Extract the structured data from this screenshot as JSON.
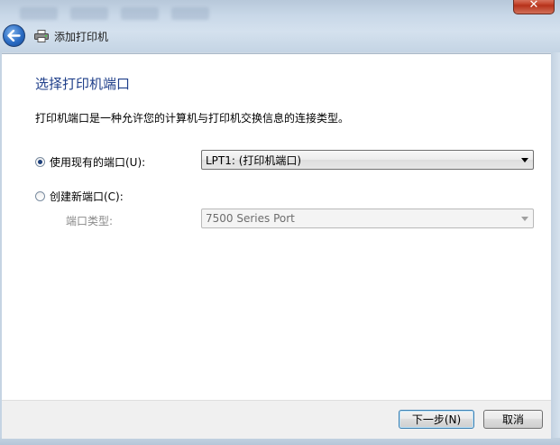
{
  "window": {
    "title": "添加打印机",
    "close_label": "✕"
  },
  "page": {
    "heading": "选择打印机端口",
    "description": "打印机端口是一种允许您的计算机与打印机交换信息的连接类型。"
  },
  "options": {
    "use_existing": {
      "label": "使用现有的端口(U):",
      "selected": true,
      "value": "LPT1: (打印机端口)"
    },
    "create_new": {
      "label": "创建新端口(C):",
      "selected": false,
      "port_type_label": "端口类型:",
      "port_type_value": "7500 Series Port"
    }
  },
  "footer": {
    "next_label": "下一步(N)",
    "cancel_label": "取消"
  },
  "colors": {
    "heading": "#1f3f8a",
    "accent": "#2a6cc4",
    "close": "#c74a32"
  },
  "icons": [
    "back-arrow-icon",
    "printer-icon",
    "close-icon",
    "dropdown-arrow-icon"
  ]
}
